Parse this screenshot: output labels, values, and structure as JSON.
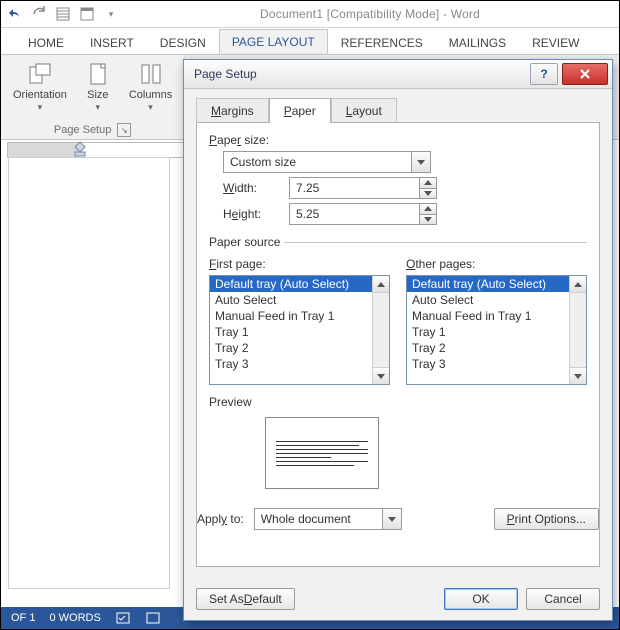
{
  "app": {
    "title": "Document1 [Compatibility Mode] - Word"
  },
  "ribbon": {
    "tabs": [
      "HOME",
      "INSERT",
      "DESIGN",
      "PAGE LAYOUT",
      "REFERENCES",
      "MAILINGS",
      "REVIEW"
    ],
    "active": "PAGE LAYOUT",
    "group_label": "Page Setup",
    "orientation": "Orientation",
    "size": "Size",
    "columns": "Columns"
  },
  "status": {
    "page": "OF 1",
    "words": "0 WORDS"
  },
  "dialog": {
    "title": "Page Setup",
    "tabs": {
      "margins": "Margins",
      "paper": "Paper",
      "layout": "Layout",
      "active": "Paper"
    },
    "paper_size_label": "Paper size:",
    "paper_size_value": "Custom size",
    "width_label": "Width:",
    "width_value": "7.25",
    "height_label": "Height:",
    "height_value": "5.25",
    "paper_source_label": "Paper source",
    "first_page_label": "First page:",
    "other_pages_label": "Other pages:",
    "tray_options": [
      "Default tray (Auto Select)",
      "Auto Select",
      "Manual Feed in Tray 1",
      "Tray 1",
      "Tray 2",
      "Tray 3"
    ],
    "preview_label": "Preview",
    "apply_to_label": "Apply to:",
    "apply_to_value": "Whole document",
    "print_options": "Print Options...",
    "set_as_default": "Set As Default",
    "ok": "OK",
    "cancel": "Cancel"
  }
}
